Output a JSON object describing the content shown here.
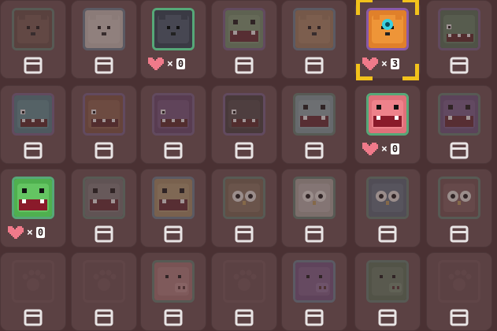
{
  "rows": [
    [
      {
        "creature": "bear",
        "face": "#7a4a3a",
        "accent": "#a86a52",
        "frame": "#4e8a6e",
        "dim": true,
        "locked": false,
        "lives": null,
        "selected": false
      },
      {
        "creature": "polar-bear",
        "face": "#d8c9b8",
        "accent": "#efe3d6",
        "frame": "#5b86a6",
        "dim": true,
        "locked": false,
        "lives": null,
        "selected": false
      },
      {
        "creature": "black-cat",
        "face": "#3a3a44",
        "accent": "#595963",
        "frame": "#56a878",
        "dim": false,
        "locked": false,
        "lives": {
          "x": "×",
          "n": "0"
        },
        "selected": false
      },
      {
        "creature": "green-frog",
        "face": "#5f9b58",
        "accent": "#7fc06f",
        "frame": "#8a5aa8",
        "dim": true,
        "locked": false,
        "lives": null,
        "selected": false
      },
      {
        "creature": "orange-bear",
        "face": "#c07a3a",
        "accent": "#e09a55",
        "frame": "#5b86a6",
        "dim": true,
        "locked": false,
        "lives": null,
        "selected": false
      },
      {
        "creature": "orange-robot-bear",
        "face": "#e0802a",
        "accent": "#ffb04a",
        "frame": "#8a5aa8",
        "dim": false,
        "locked": false,
        "lives": {
          "x": "×",
          "n": "3"
        },
        "selected": true
      },
      {
        "creature": "green-dragon",
        "face": "#3f7a45",
        "accent": "#5fa866",
        "frame": "#8a5aa8",
        "dim": true,
        "locked": false,
        "lives": null,
        "selected": false
      }
    ],
    [
      {
        "creature": "blue-dragon",
        "face": "#2f8a9a",
        "accent": "#4fb0c0",
        "frame": "#8a5aa8",
        "dim": true,
        "locked": false,
        "lives": null,
        "selected": false
      },
      {
        "creature": "red-dragon",
        "face": "#a24a2a",
        "accent": "#c9743a",
        "frame": "#8a5aa8",
        "dim": true,
        "locked": false,
        "lives": null,
        "selected": false
      },
      {
        "creature": "purple-dragon",
        "face": "#7a3a8a",
        "accent": "#a062b2",
        "frame": "#8a5aa8",
        "dim": true,
        "locked": false,
        "lives": null,
        "selected": false
      },
      {
        "creature": "dark-dragon",
        "face": "#4a3a3a",
        "accent": "#6a5454",
        "frame": "#8a5aa8",
        "dim": true,
        "locked": false,
        "lives": null,
        "selected": false
      },
      {
        "creature": "blue-hippo",
        "face": "#6fa8b0",
        "accent": "#8fc8ce",
        "frame": "#4e8a6e",
        "dim": true,
        "locked": false,
        "lives": null,
        "selected": false
      },
      {
        "creature": "pink-hippo",
        "face": "#e0707a",
        "accent": "#ff98a0",
        "frame": "#56a878",
        "dim": false,
        "locked": false,
        "lives": {
          "x": "×",
          "n": "0"
        },
        "selected": false
      },
      {
        "creature": "purple-hippo",
        "face": "#7a4aa0",
        "accent": "#9a6ac0",
        "frame": "#4e8a6e",
        "dim": true,
        "locked": false,
        "lives": null,
        "selected": false
      }
    ],
    [
      {
        "creature": "green-hippo",
        "face": "#4fb04f",
        "accent": "#7ee07a",
        "frame": "#56a878",
        "dim": false,
        "locked": false,
        "lives": {
          "x": "×",
          "n": "0"
        },
        "selected": false
      },
      {
        "creature": "grey-hippo",
        "face": "#7a7272",
        "accent": "#9a9292",
        "frame": "#4e8a6e",
        "dim": true,
        "locked": false,
        "lives": null,
        "selected": false
      },
      {
        "creature": "yellow-hippo",
        "face": "#c09040",
        "accent": "#e0b060",
        "frame": "#5b86a6",
        "dim": true,
        "locked": false,
        "lives": null,
        "selected": false
      },
      {
        "creature": "brown-owl",
        "face": "#8a6440",
        "accent": "#b08a60",
        "frame": "#4e8a6e",
        "dim": true,
        "locked": false,
        "lives": null,
        "selected": false
      },
      {
        "creature": "white-owl",
        "face": "#b8aca0",
        "accent": "#dcd2c6",
        "frame": "#4e8a6e",
        "dim": true,
        "locked": false,
        "lives": null,
        "selected": false
      },
      {
        "creature": "blue-owl",
        "face": "#4a6a8a",
        "accent": "#6a8aaa",
        "frame": "#4e8a6e",
        "dim": true,
        "locked": false,
        "lives": null,
        "selected": false
      },
      {
        "creature": "red-owl",
        "face": "#8a4a4a",
        "accent": "#b06a6a",
        "frame": "#4e8a6e",
        "dim": true,
        "locked": false,
        "lives": null,
        "selected": false
      }
    ],
    [
      {
        "creature": "locked",
        "face": "#5b4143",
        "accent": "#6a4f51",
        "frame": "#6a4f51",
        "dim": false,
        "locked": true,
        "lives": null,
        "selected": false
      },
      {
        "creature": "locked",
        "face": "#5b4143",
        "accent": "#6a4f51",
        "frame": "#6a4f51",
        "dim": false,
        "locked": true,
        "lives": null,
        "selected": false
      },
      {
        "creature": "pink-pig",
        "face": "#d06a6a",
        "accent": "#ea8c8c",
        "frame": "#4e8a6e",
        "dim": true,
        "locked": false,
        "lives": null,
        "selected": false
      },
      {
        "creature": "locked",
        "face": "#5b4143",
        "accent": "#6a4f51",
        "frame": "#6a4f51",
        "dim": false,
        "locked": true,
        "lives": null,
        "selected": false
      },
      {
        "creature": "purple-pig",
        "face": "#8a4aa0",
        "accent": "#a86ac0",
        "frame": "#5b86a6",
        "dim": true,
        "locked": false,
        "lives": null,
        "selected": false
      },
      {
        "creature": "green-pig",
        "face": "#4a7a4a",
        "accent": "#6a9a6a",
        "frame": "#4e8a6e",
        "dim": true,
        "locked": false,
        "lives": null,
        "selected": false
      },
      {
        "creature": "locked",
        "face": "#5b4143",
        "accent": "#6a4f51",
        "frame": "#6a4f51",
        "dim": false,
        "locked": true,
        "lives": null,
        "selected": false
      }
    ]
  ],
  "colors": {
    "background": "#4a3133",
    "cell": "#5b4143",
    "heart": "#f07a8a",
    "cursor": "#f2c21b",
    "box": "#e8e4e4"
  }
}
